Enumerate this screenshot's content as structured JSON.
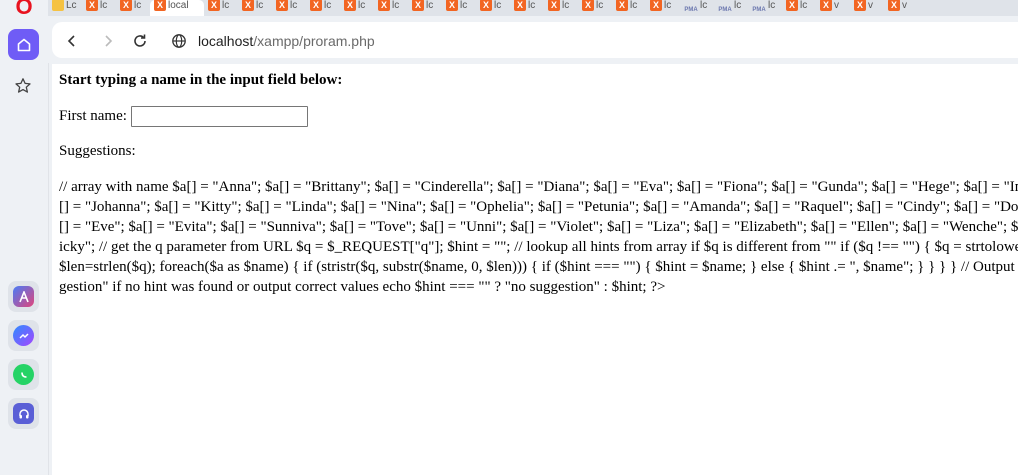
{
  "browser": {
    "tabs": [
      {
        "label": "Lc",
        "icon": "folder-icon"
      },
      {
        "label": "lc",
        "icon": "xampp-icon"
      },
      {
        "label": "lc",
        "icon": "xampp-icon"
      },
      {
        "label": "local",
        "icon": "xampp-icon",
        "active": true
      },
      {
        "label": "lc",
        "icon": "xampp-icon"
      },
      {
        "label": "lc",
        "icon": "xampp-icon"
      },
      {
        "label": "lc",
        "icon": "xampp-icon"
      },
      {
        "label": "lc",
        "icon": "xampp-icon"
      },
      {
        "label": "lc",
        "icon": "xampp-icon"
      },
      {
        "label": "lc",
        "icon": "xampp-icon"
      },
      {
        "label": "lc",
        "icon": "xampp-icon"
      },
      {
        "label": "lc",
        "icon": "xampp-icon"
      },
      {
        "label": "lc",
        "icon": "xampp-icon"
      },
      {
        "label": "lc",
        "icon": "xampp-icon"
      },
      {
        "label": "lc",
        "icon": "xampp-icon"
      },
      {
        "label": "lc",
        "icon": "xampp-icon"
      },
      {
        "label": "lc",
        "icon": "xampp-icon"
      },
      {
        "label": "lc",
        "icon": "xampp-icon"
      },
      {
        "label": "lc",
        "icon": "phpmyadmin-icon"
      },
      {
        "label": "lc",
        "icon": "phpmyadmin-icon"
      },
      {
        "label": "lc",
        "icon": "phpmyadmin-icon"
      },
      {
        "label": "lc",
        "icon": "xampp-icon"
      },
      {
        "label": "v",
        "icon": "xampp-icon"
      },
      {
        "label": "v",
        "icon": "xampp-icon"
      },
      {
        "label": "v",
        "icon": "xampp-icon"
      }
    ],
    "url_host": "localhost",
    "url_path": "/xampp/proram.php"
  },
  "sidebar": {
    "logo": "O"
  },
  "page": {
    "heading": "Start typing a name in the input field below:",
    "first_name_label": "First name:",
    "first_name_value": "",
    "suggestions_label": "Suggestions:",
    "code_text": "// array with name $a[] = \"Anna\"; $a[] = \"Brittany\"; $a[] = \"Cinderella\"; $a[] = \"Diana\"; $a[] = \"Eva\"; $a[] = \"Fiona\"; $a[] = \"Gunda\"; $a[] = \"Hege\"; $a[] = \"Inga\"; $a[] = \"Johanna\"; $a[] = \"Kitty\"; $a[] = \"Linda\"; $a[] = \"Nina\"; $a[] = \"Ophelia\"; $a[] = \"Petunia\"; $a[] = \"Amanda\"; $a[] = \"Raquel\"; $a[] = \"Cindy\"; $a[] = \"Doris\"; $a[] = \"Eve\"; $a[] = \"Evita\"; $a[] = \"Sunniva\"; $a[] = \"Tove\"; $a[] = \"Unni\"; $a[] = \"Violet\"; $a[] = \"Liza\"; $a[] = \"Elizabeth\"; $a[] = \"Ellen\"; $a[] = \"Wenche\"; $a[] = \"Vicky\"; // get the q parameter from URL $q = $_REQUEST[\"q\"]; $hint = \"\"; // lookup all hints from array if $q is different from \"\" if ($q !== \"\") { $q = strtolower($q); $len=strlen($q); foreach($a as $name) { if (stristr($q, substr($name, 0, $len))) { if ($hint === \"\") { $hint = $name; } else { $hint .= \", $name\"; } } } } // Output \"no suggestion\" if no hint was found or output correct values echo $hint === \"\" ? \"no suggestion\" : $hint; ?>"
  }
}
